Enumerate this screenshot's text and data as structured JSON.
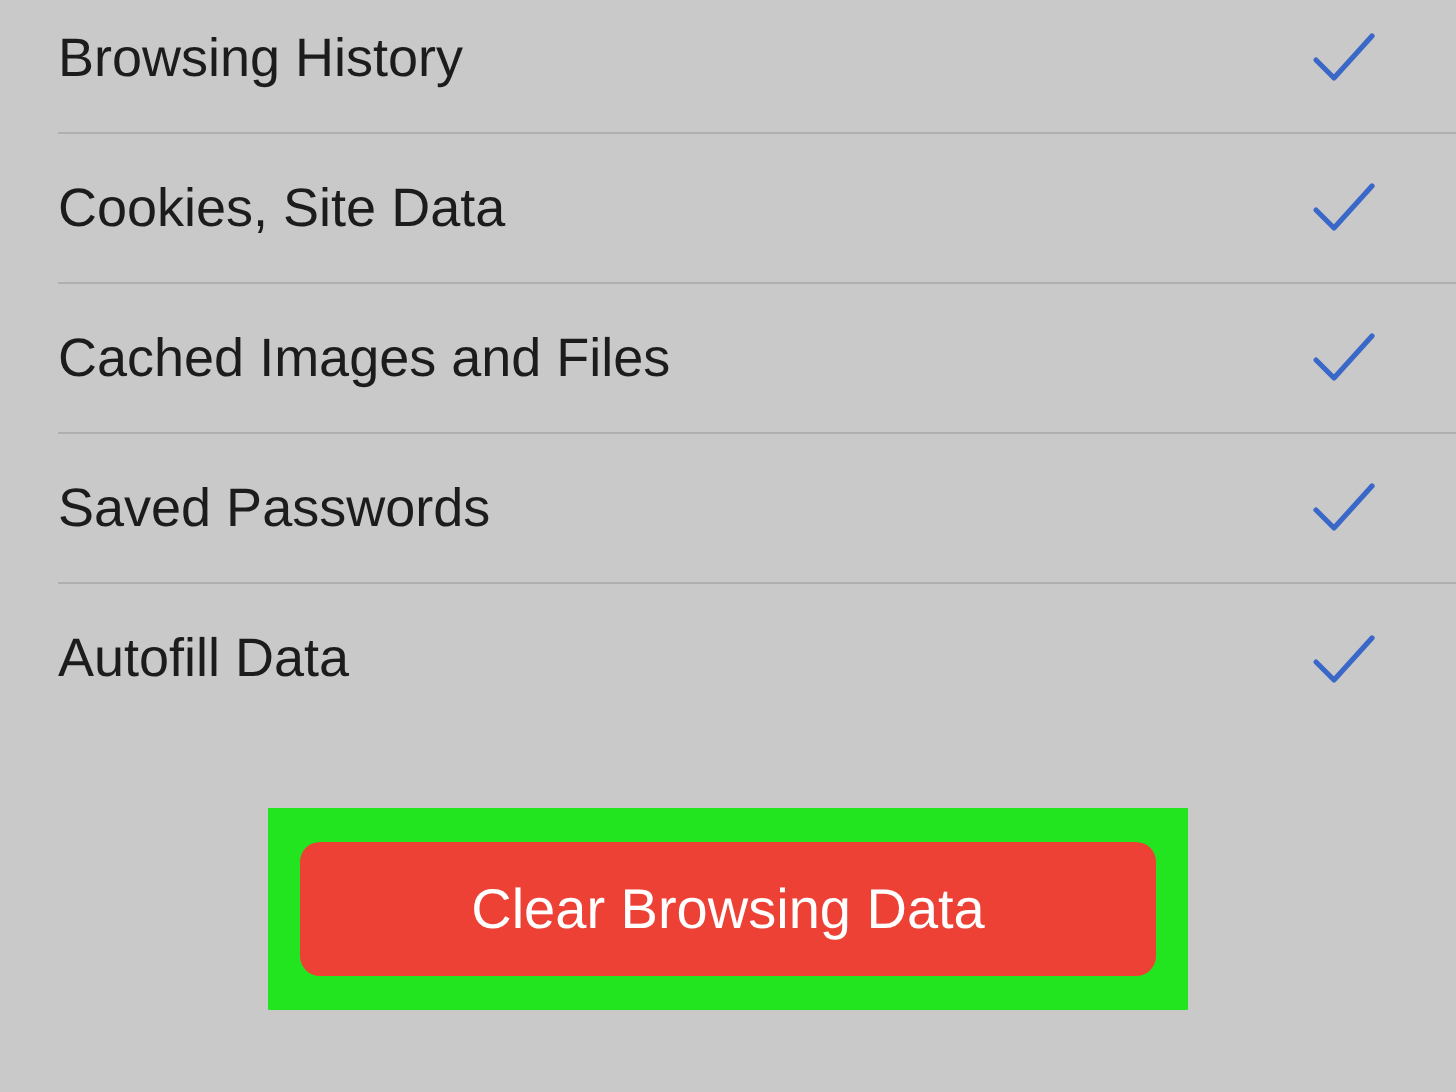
{
  "options": [
    {
      "label": "Browsing History",
      "checked": true
    },
    {
      "label": "Cookies, Site Data",
      "checked": true
    },
    {
      "label": "Cached Images and Files",
      "checked": true
    },
    {
      "label": "Saved Passwords",
      "checked": true
    },
    {
      "label": "Autofill Data",
      "checked": true
    }
  ],
  "clear_button": {
    "label": "Clear Browsing Data",
    "highlighted": true
  }
}
